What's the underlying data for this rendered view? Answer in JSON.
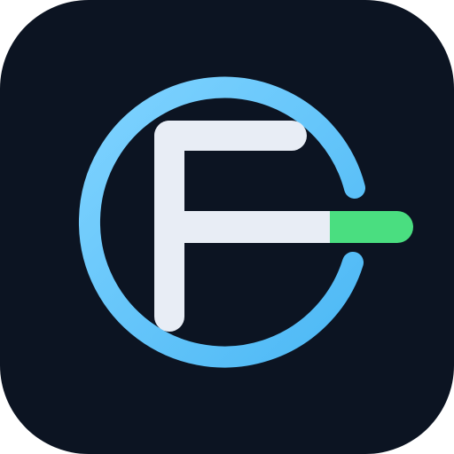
{
  "icon": {
    "name": "app-logo-icon",
    "colors": {
      "tile": "#0c1422",
      "ring_start": "#7fd3ff",
      "ring_end": "#4cb8f5",
      "letter": "#e8edf5",
      "accent": "#4ade80"
    }
  }
}
